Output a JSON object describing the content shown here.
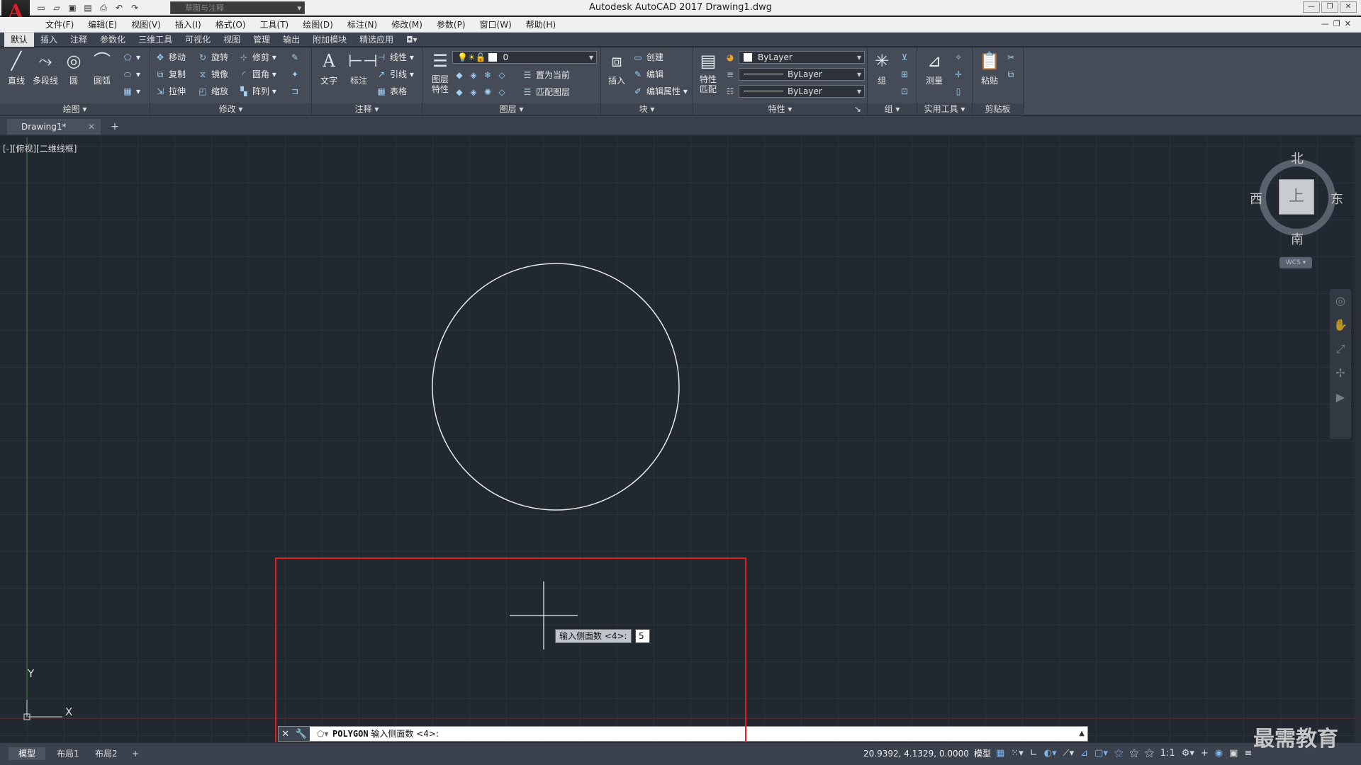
{
  "window": {
    "title": "Autodesk AutoCAD 2017    Drawing1.dwg",
    "logo": "A",
    "workspace": "草图与注释"
  },
  "menu": [
    "文件(F)",
    "编辑(E)",
    "视图(V)",
    "插入(I)",
    "格式(O)",
    "工具(T)",
    "绘图(D)",
    "标注(N)",
    "修改(M)",
    "参数(P)",
    "窗口(W)",
    "帮助(H)"
  ],
  "ribbon_tabs": [
    "默认",
    "插入",
    "注释",
    "参数化",
    "三维工具",
    "可视化",
    "视图",
    "管理",
    "输出",
    "附加模块",
    "精选应用"
  ],
  "ribbon": {
    "draw": {
      "title": "绘图",
      "line": "直线",
      "polyline": "多段线",
      "circle": "圆",
      "arc": "圆弧"
    },
    "modify": {
      "title": "修改",
      "move": "移动",
      "rotate": "旋转",
      "trim": "修剪",
      "copy": "复制",
      "mirror": "镜像",
      "fillet": "圆角",
      "stretch": "拉伸",
      "scale": "缩放",
      "array": "阵列"
    },
    "annotation": {
      "title": "注释",
      "text": "文字",
      "dim": "标注",
      "linear": "线性",
      "leader": "引线",
      "table": "表格"
    },
    "layers": {
      "title": "图层",
      "props": "图层特性",
      "current_layer": "0",
      "set_current": "置为当前",
      "match": "匹配图层"
    },
    "block": {
      "title": "块",
      "insert": "插入",
      "create": "创建",
      "edit": "编辑",
      "edit_attr": "编辑属性"
    },
    "properties": {
      "title": "特性",
      "match": "特性匹配",
      "color": "ByLayer",
      "linetype": "ByLayer",
      "lineweight": "ByLayer"
    },
    "groups": {
      "title": "组",
      "group": "组"
    },
    "utilities": {
      "title": "实用工具",
      "measure": "测量"
    },
    "clipboard": {
      "title": "剪贴板",
      "paste": "粘贴"
    }
  },
  "doc_tab": {
    "name": "Drawing1*",
    "close": "✕",
    "new": "+"
  },
  "viewport_label": "[-][俯视][二维线框]",
  "viewcube": {
    "north": "北",
    "south": "南",
    "east": "东",
    "west": "西",
    "face": "上",
    "wcs": "WCS"
  },
  "ucs": {
    "x": "X",
    "y": "Y"
  },
  "dynamic_input": {
    "prompt": "输入侧面数 <4>:",
    "value": "5"
  },
  "command_line": {
    "command": "POLYGON",
    "prompt": "输入侧面数 <4>:"
  },
  "layout_tabs": [
    "模型",
    "布局1",
    "布局2"
  ],
  "status": {
    "coords": "20.9392, 4.1329, 0.0000",
    "space": "模型",
    "scale": "1:1"
  },
  "watermark": "最需教育",
  "colors": {
    "canvas": "#212830",
    "highlight": "#e02020",
    "ribbon": "#454c58"
  }
}
